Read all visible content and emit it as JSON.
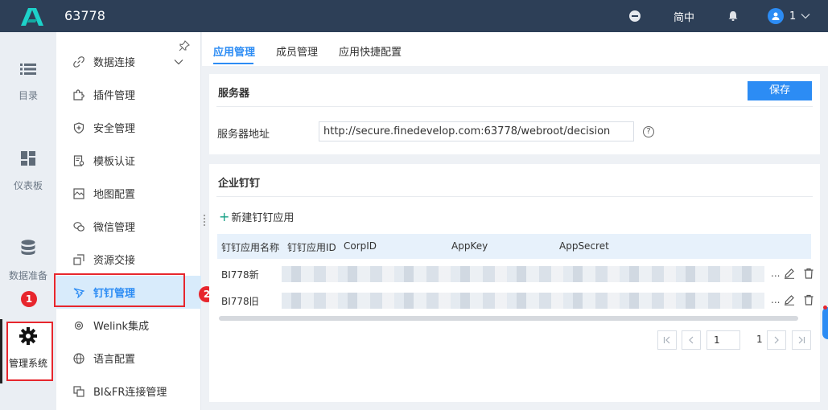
{
  "header": {
    "title": "63778",
    "language": "简中",
    "user": "1",
    "colors": {
      "bar": "#2d3f57",
      "accent": "#2c8cf4"
    }
  },
  "rail": {
    "items": [
      {
        "label": "目录",
        "icon": "list-icon"
      },
      {
        "label": "仪表板",
        "icon": "dashboard-icon"
      },
      {
        "label": "数据准备",
        "icon": "database-icon"
      },
      {
        "label": "管理系统",
        "icon": "gear-icon"
      }
    ]
  },
  "submenu": {
    "items": [
      {
        "label": "数据连接",
        "icon": "link-icon"
      },
      {
        "label": "插件管理",
        "icon": "puzzle-icon"
      },
      {
        "label": "安全管理",
        "icon": "shield-icon"
      },
      {
        "label": "模板认证",
        "icon": "certificate-icon"
      },
      {
        "label": "地图配置",
        "icon": "map-icon"
      },
      {
        "label": "微信管理",
        "icon": "wechat-icon"
      },
      {
        "label": "资源交接",
        "icon": "handover-icon"
      },
      {
        "label": "钉钉管理",
        "icon": "dingtalk-icon"
      },
      {
        "label": "Welink集成",
        "icon": "gear-outline-icon"
      },
      {
        "label": "语言配置",
        "icon": "globe-icon"
      },
      {
        "label": "BI&FR连接管理",
        "icon": "copy-icon"
      }
    ]
  },
  "markers": {
    "one": "1",
    "two": "2"
  },
  "tabs": [
    "应用管理",
    "成员管理",
    "应用快捷配置"
  ],
  "server": {
    "title": "服务器",
    "save_label": "保存",
    "address_label": "服务器地址",
    "address_value": "http://secure.finedevelop.com:63778/webroot/decision",
    "help": "?"
  },
  "dingtalk": {
    "title": "企业钉钉",
    "add_label": "新建钉钉应用",
    "columns": [
      "钉钉应用名称",
      "钉钉应用ID",
      "CorpID",
      "AppKey",
      "AppSecret"
    ],
    "rows": [
      {
        "name": "BI778新"
      },
      {
        "name": "BI778旧"
      }
    ],
    "ellipsis": "..."
  },
  "pagination": {
    "current": "1",
    "total": "1"
  }
}
